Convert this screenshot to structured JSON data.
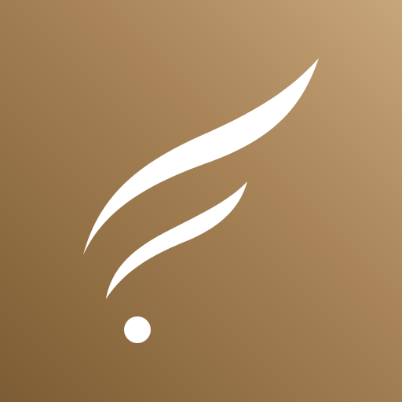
{
  "app_icon": {
    "name": "feather-logo-icon",
    "background_colors": [
      "#c7a679",
      "#a88458",
      "#8f6d42",
      "#7c5c34"
    ],
    "mark_color": "#ffffff"
  }
}
